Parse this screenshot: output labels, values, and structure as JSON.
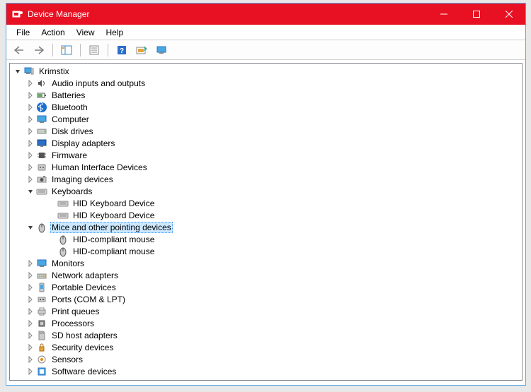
{
  "window": {
    "title": "Device Manager"
  },
  "menu": {
    "file": "File",
    "action": "Action",
    "view": "View",
    "help": "Help"
  },
  "tree": {
    "root": "Krimstix",
    "nodes": [
      {
        "label": "Audio inputs and outputs",
        "expanded": false,
        "icon": "speaker"
      },
      {
        "label": "Batteries",
        "expanded": false,
        "icon": "battery"
      },
      {
        "label": "Bluetooth",
        "expanded": false,
        "icon": "bluetooth"
      },
      {
        "label": "Computer",
        "expanded": false,
        "icon": "monitor"
      },
      {
        "label": "Disk drives",
        "expanded": false,
        "icon": "disk"
      },
      {
        "label": "Display adapters",
        "expanded": false,
        "icon": "display"
      },
      {
        "label": "Firmware",
        "expanded": false,
        "icon": "chip"
      },
      {
        "label": "Human Interface Devices",
        "expanded": false,
        "icon": "hid"
      },
      {
        "label": "Imaging devices",
        "expanded": false,
        "icon": "camera"
      },
      {
        "label": "Keyboards",
        "expanded": true,
        "icon": "keyboard",
        "children": [
          {
            "label": "HID Keyboard Device",
            "icon": "keyboard"
          },
          {
            "label": "HID Keyboard Device",
            "icon": "keyboard"
          }
        ]
      },
      {
        "label": "Mice and other pointing devices",
        "expanded": true,
        "icon": "mouse",
        "selected": true,
        "children": [
          {
            "label": "HID-compliant mouse",
            "icon": "mouse"
          },
          {
            "label": "HID-compliant mouse",
            "icon": "mouse"
          }
        ]
      },
      {
        "label": "Monitors",
        "expanded": false,
        "icon": "monitor"
      },
      {
        "label": "Network adapters",
        "expanded": false,
        "icon": "network"
      },
      {
        "label": "Portable Devices",
        "expanded": false,
        "icon": "portable"
      },
      {
        "label": "Ports (COM & LPT)",
        "expanded": false,
        "icon": "port"
      },
      {
        "label": "Print queues",
        "expanded": false,
        "icon": "printer"
      },
      {
        "label": "Processors",
        "expanded": false,
        "icon": "cpu"
      },
      {
        "label": "SD host adapters",
        "expanded": false,
        "icon": "sd"
      },
      {
        "label": "Security devices",
        "expanded": false,
        "icon": "security"
      },
      {
        "label": "Sensors",
        "expanded": false,
        "icon": "sensor"
      },
      {
        "label": "Software devices",
        "expanded": false,
        "icon": "software"
      }
    ]
  }
}
